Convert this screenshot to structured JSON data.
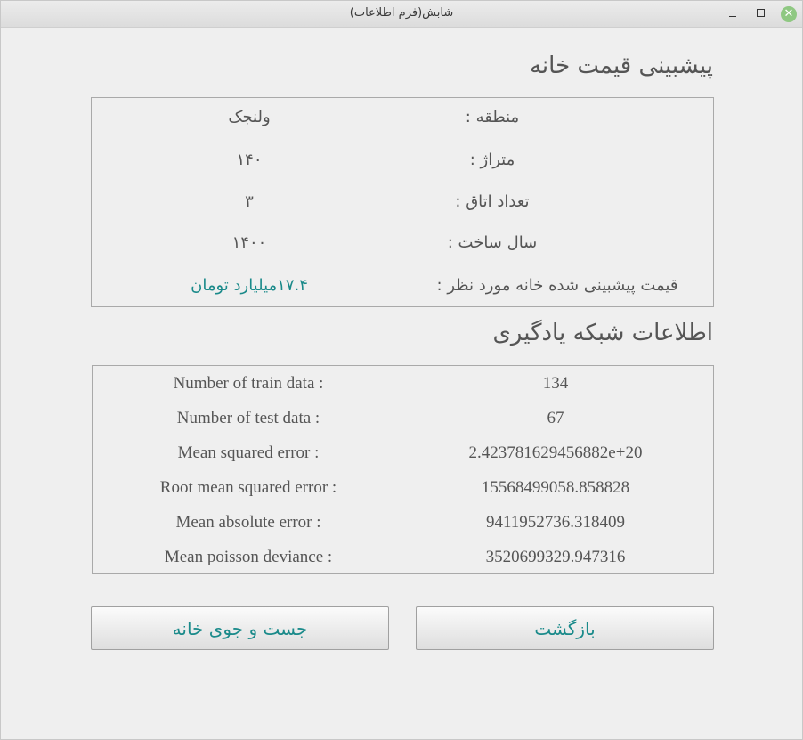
{
  "window": {
    "title": "شابش(فرم اطلاعات)",
    "minimize_icon": "minimize-icon",
    "maximize_icon": "maximize-icon",
    "close_icon": "close-icon",
    "close_color": "#8fc882"
  },
  "prediction": {
    "heading": "پیشبینی قیمت خانه",
    "rows": [
      {
        "label": "منطقه :",
        "value": "ولنجک"
      },
      {
        "label": "متراژ :",
        "value": "۱۴۰"
      },
      {
        "label": "تعداد اتاق :",
        "value": "۳"
      },
      {
        "label": "سال ساخت :",
        "value": "۱۴۰۰"
      },
      {
        "label": "قیمت پیشبینی شده خانه مورد نظر :",
        "value": "۱۷.۴میلیارد تومان"
      }
    ],
    "accent_color": "#1a8a8a"
  },
  "network": {
    "heading": "اطلاعات شبکه یادگیری",
    "rows": [
      {
        "label": "Number of train data :",
        "value": "134"
      },
      {
        "label": "Number of test data :",
        "value": "67"
      },
      {
        "label": "Mean squared error :",
        "value": "2.423781629456882e+20"
      },
      {
        "label": "Root mean squared error :",
        "value": "15568499058.858828"
      },
      {
        "label": "Mean absolute error :",
        "value": "9411952736.318409"
      },
      {
        "label": "Mean poisson deviance :",
        "value": "3520699329.947316"
      }
    ]
  },
  "buttons": {
    "search_label": "جست و جوی خانه",
    "back_label": "بازگشت"
  }
}
